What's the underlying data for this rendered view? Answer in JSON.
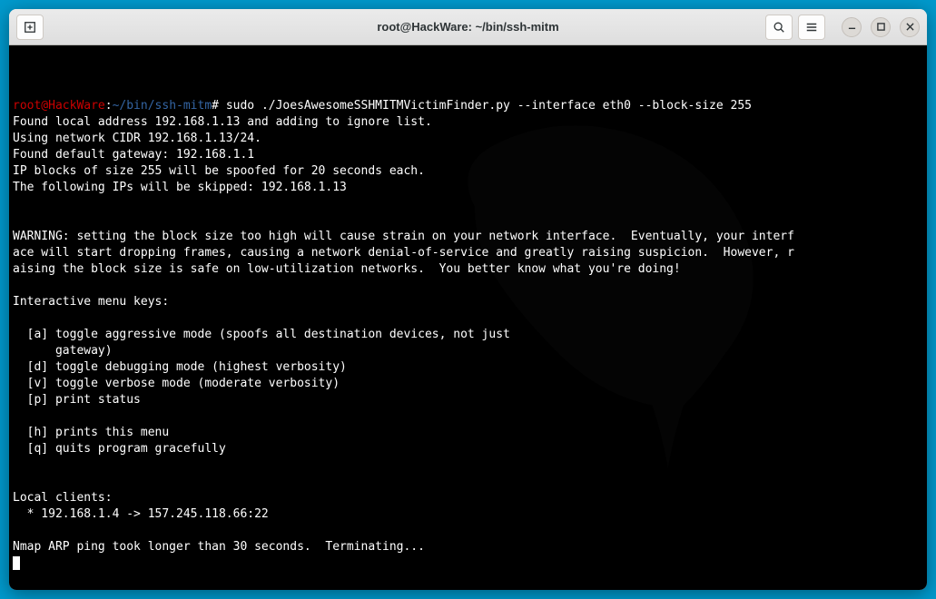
{
  "titlebar": {
    "title": "root@HackWare: ~/bin/ssh-mitm"
  },
  "prompt": {
    "user_host": "root@HackWare",
    "separator": ":",
    "path": "~/bin/ssh-mitm",
    "hash": "#"
  },
  "command": "sudo ./JoesAwesomeSSHMITMVictimFinder.py --interface eth0 --block-size 255",
  "output": {
    "line1": "Found local address 192.168.1.13 and adding to ignore list.",
    "line2": "Using network CIDR 192.168.1.13/24.",
    "line3": "Found default gateway: 192.168.1.1",
    "line4": "IP blocks of size 255 will be spoofed for 20 seconds each.",
    "line5": "The following IPs will be skipped: 192.168.1.13",
    "warning1": "WARNING: setting the block size too high will cause strain on your network interface.  Eventually, your interf",
    "warning2": "ace will start dropping frames, causing a network denial-of-service and greatly raising suspicion.  However, r",
    "warning3": "aising the block size is safe on low-utilization networks.  You better know what you're doing!",
    "menu_header": "Interactive menu keys:",
    "menu_a1": "  [a] toggle aggressive mode (spoofs all destination devices, not just",
    "menu_a2": "      gateway)",
    "menu_d": "  [d] toggle debugging mode (highest verbosity)",
    "menu_v": "  [v] toggle verbose mode (moderate verbosity)",
    "menu_p": "  [p] print status",
    "menu_h": "  [h] prints this menu",
    "menu_q": "  [q] quits program gracefully",
    "clients_header": "Local clients:",
    "client1": "  * 192.168.1.4 -> 157.245.118.66:22",
    "nmap": "Nmap ARP ping took longer than 30 seconds.  Terminating..."
  }
}
